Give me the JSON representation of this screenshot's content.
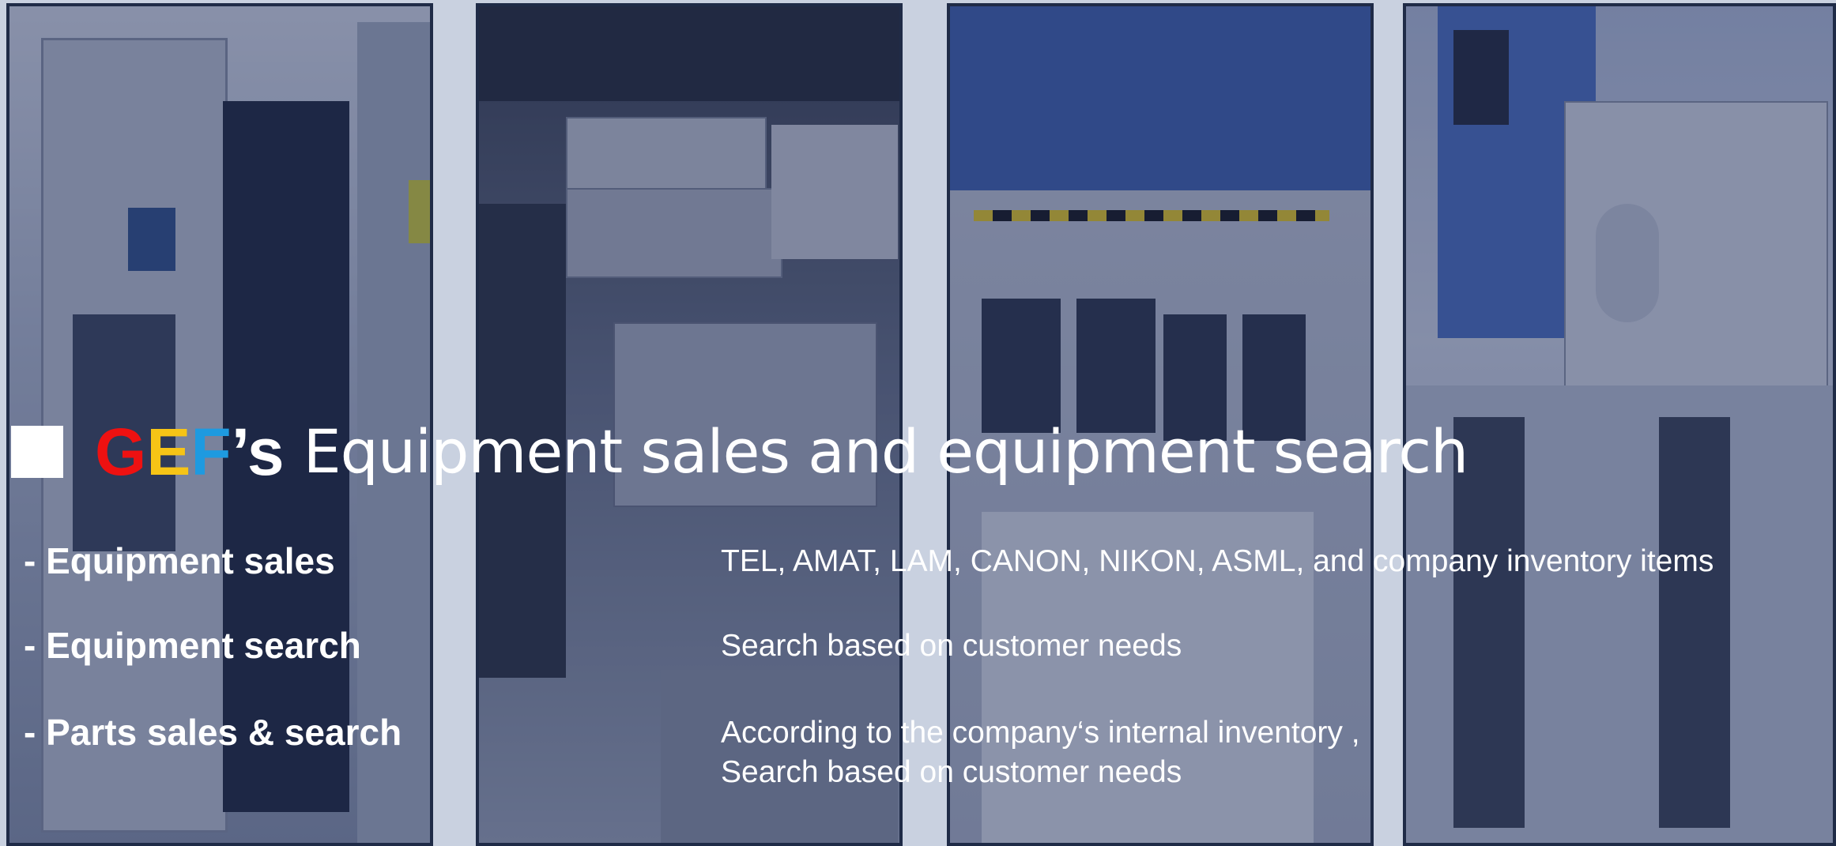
{
  "title": {
    "brand_g": "G",
    "brand_e": "E",
    "brand_f": "F",
    "brand_s": "’s",
    "text": "Equipment sales and equipment search"
  },
  "rows": [
    {
      "label": "- Equipment sales",
      "desc": "TEL, AMAT, LAM, CANON, NIKON, ASML, and company inventory items"
    },
    {
      "label": "- Equipment search",
      "desc": "Search based on customer needs"
    },
    {
      "label": "- Parts sales & search",
      "desc": "According to the company‘s internal inventory  ,",
      "desc2": " Search based on customer needs"
    }
  ],
  "colors": {
    "brand_g": "#ee1111",
    "brand_e": "#f6c416",
    "brand_f": "#1e9ae0",
    "panel_border": "#1f2b47",
    "overlay": "#1e2d5a"
  }
}
